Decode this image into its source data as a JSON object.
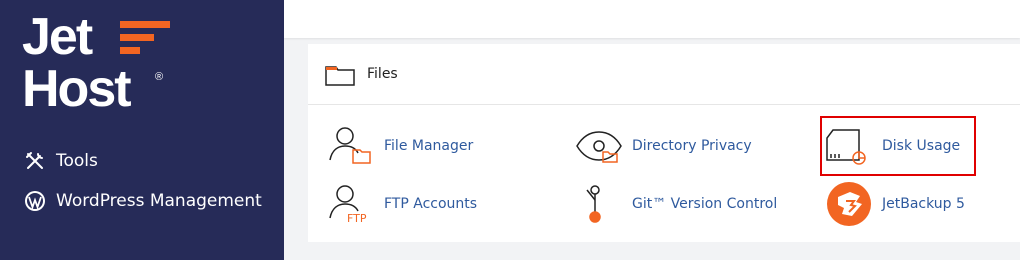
{
  "brand": {
    "line1": "Jet",
    "line2": "Host",
    "registered": "®",
    "accent_color": "#f26522",
    "sidebar_color": "#262b58"
  },
  "sidebar": {
    "items": [
      {
        "label": "Tools",
        "icon": "tools-icon"
      },
      {
        "label": "WordPress Management",
        "icon": "wordpress-icon"
      }
    ]
  },
  "panel": {
    "title": "Files",
    "icon": "folder-icon",
    "tools": [
      {
        "label": "File Manager",
        "icon": "file-manager-icon"
      },
      {
        "label": "Directory Privacy",
        "icon": "directory-privacy-icon"
      },
      {
        "label": "Disk Usage",
        "icon": "disk-usage-icon",
        "highlighted": true
      },
      {
        "label": "FTP Accounts",
        "icon": "ftp-accounts-icon",
        "icon_text": "FTP"
      },
      {
        "label": "Git™ Version Control",
        "icon": "git-icon"
      },
      {
        "label": "JetBackup 5",
        "icon": "jetbackup-icon"
      }
    ]
  },
  "colors": {
    "link": "#2f5a9e",
    "highlight_border": "#e00000",
    "icon_accent": "#f26522"
  }
}
